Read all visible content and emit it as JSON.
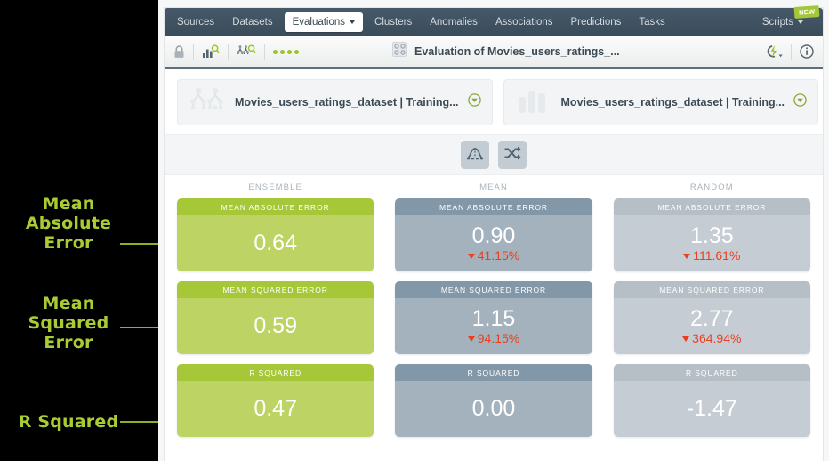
{
  "topnav": {
    "items": [
      {
        "label": "Sources",
        "active": false,
        "caret": false
      },
      {
        "label": "Datasets",
        "active": false,
        "caret": false
      },
      {
        "label": "Evaluations",
        "active": true,
        "caret": true
      },
      {
        "label": "Clusters",
        "active": false,
        "caret": false
      },
      {
        "label": "Anomalies",
        "active": false,
        "caret": false
      },
      {
        "label": "Associations",
        "active": false,
        "caret": false
      },
      {
        "label": "Predictions",
        "active": false,
        "caret": false
      },
      {
        "label": "Tasks",
        "active": false,
        "caret": false
      }
    ],
    "right": {
      "label": "Scripts",
      "badge": "NEW",
      "badge_color": "#a4c639"
    }
  },
  "toolbar": {
    "lock_icon": "lock-icon",
    "chart_search_icon": "bar-chart-search-icon",
    "tree_search_icon": "tree-search-icon",
    "status_dots": 4,
    "status_dot_color": "#9fc22c",
    "resource_icon": "evaluation-grid-icon",
    "title": "Evaluation of Movies_users_ratings_...",
    "action_icon": "flash-action-icon",
    "info_icon": "info-circle-icon"
  },
  "selectors": [
    {
      "icon": "model-tree-icon",
      "label": "Movies_users_ratings_dataset | Training...",
      "dropdown_icon": "chevron-down-circle-icon"
    },
    {
      "icon": "bar-chart-icon",
      "label": "Movies_users_ratings_dataset | Training...",
      "dropdown_icon": "chevron-down-circle-icon"
    }
  ],
  "action_buttons": [
    {
      "icon": "normal-distribution-icon",
      "name": "mean-comparison-button"
    },
    {
      "icon": "shuffle-icon",
      "name": "random-comparison-button"
    }
  ],
  "metrics": {
    "columns": [
      "ENSEMBLE",
      "MEAN",
      "RANDOM"
    ],
    "column_variants": [
      "v-ens",
      "v-mean",
      "v-rand"
    ],
    "rows": [
      {
        "title": "MEAN ABSOLUTE ERROR",
        "annotation": "Mean Absolute Error",
        "cells": [
          {
            "value": "0.64",
            "delta": null
          },
          {
            "value": "0.90",
            "delta": "41.15%"
          },
          {
            "value": "1.35",
            "delta": "111.61%"
          }
        ]
      },
      {
        "title": "MEAN SQUARED ERROR",
        "annotation": "Mean Squared Error",
        "cells": [
          {
            "value": "0.59",
            "delta": null
          },
          {
            "value": "1.15",
            "delta": "94.15%"
          },
          {
            "value": "2.77",
            "delta": "364.94%"
          }
        ]
      },
      {
        "title": "R SQUARED",
        "annotation": "R Squared",
        "cells": [
          {
            "value": "0.47",
            "delta": null
          },
          {
            "value": "0.00",
            "delta": null
          },
          {
            "value": "-1.47",
            "delta": null
          }
        ]
      }
    ]
  },
  "annotations": [
    {
      "text": "Mean\nAbsolute\nError",
      "color": "#aacc33"
    },
    {
      "text": "Mean\nSquared\nError",
      "color": "#aacc33"
    },
    {
      "text": "R Squared",
      "color": "#aacc33"
    }
  ],
  "colors": {
    "ensemble_head": "#a6c838",
    "ensemble_body": "#bdd363",
    "mean_head": "#8298a8",
    "mean_body": "#a4b2bd",
    "random_head": "#b6bec6",
    "random_body": "#c6ccd3",
    "delta_red": "#e8401f",
    "nav_bg": "#3f5361",
    "annotation_green": "#aacc33"
  }
}
